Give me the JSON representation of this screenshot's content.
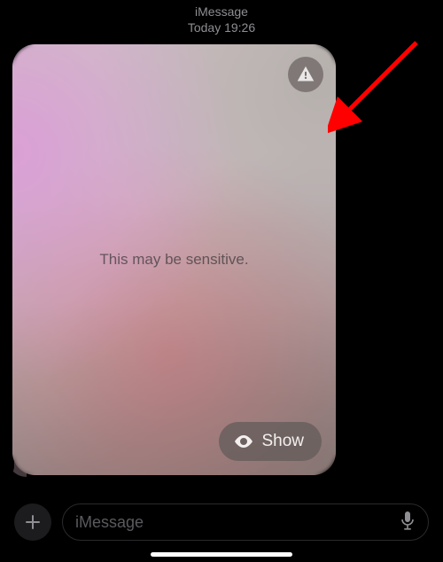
{
  "header": {
    "service": "iMessage",
    "timestamp": "Today 19:26"
  },
  "bubble": {
    "sensitive_label": "This may be sensitive.",
    "show_label": "Show",
    "warn_icon": "warning-icon",
    "eye_icon": "eye-icon"
  },
  "composer": {
    "placeholder": "iMessage",
    "value": "",
    "add_icon": "plus-icon",
    "mic_icon": "mic-icon"
  },
  "annotation": {
    "arrow_color": "#ff0000"
  }
}
